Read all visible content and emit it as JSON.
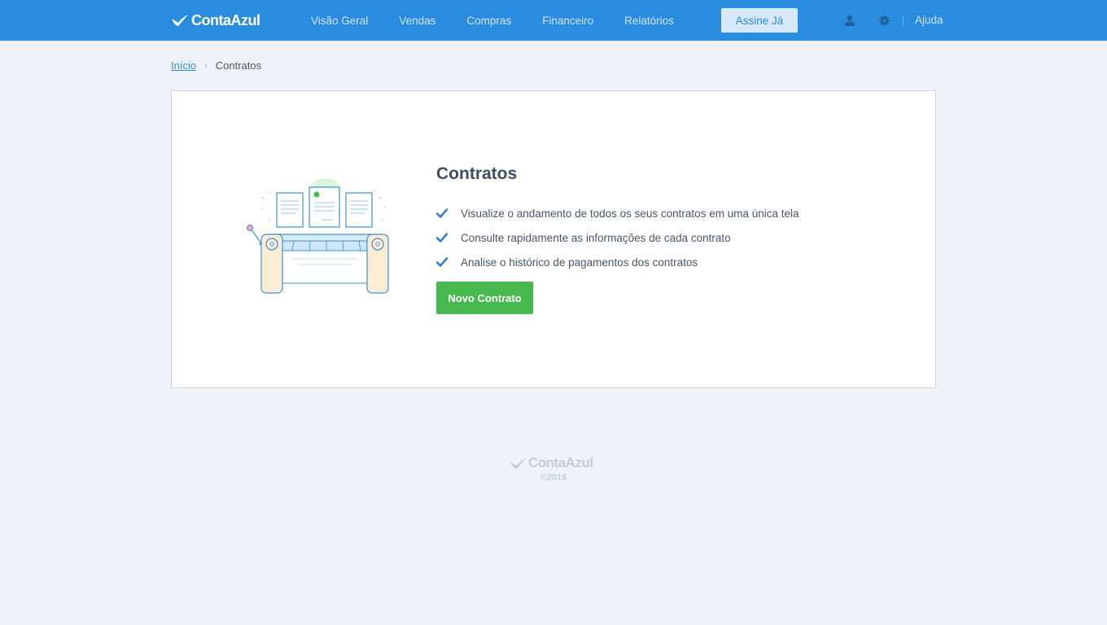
{
  "header": {
    "logo_text": "ContaAzul",
    "nav": [
      "Visão Geral",
      "Vendas",
      "Compras",
      "Financeiro",
      "Relatórios"
    ],
    "subscribe_label": "Assine Já",
    "help_label": "Ajuda",
    "icons": [
      "user-icon",
      "gear-icon"
    ]
  },
  "breadcrumb": {
    "home": "Início",
    "current": "Contratos"
  },
  "main": {
    "title": "Contratos",
    "features": [
      "Visualize o andamento de todos os seus contratos em uma única tela",
      "Consulte rapidamente as informações de cada contrato",
      "Analise o histórico de pagamentos dos contratos"
    ],
    "new_button": "Novo Contrato"
  },
  "footer": {
    "logo_text": "ContaAzul",
    "copyright": "©2016"
  },
  "colors": {
    "header_bg": "#2a8cde",
    "page_bg": "#eff3f8",
    "primary_button": "#47b94f",
    "check": "#3a7bc8"
  }
}
